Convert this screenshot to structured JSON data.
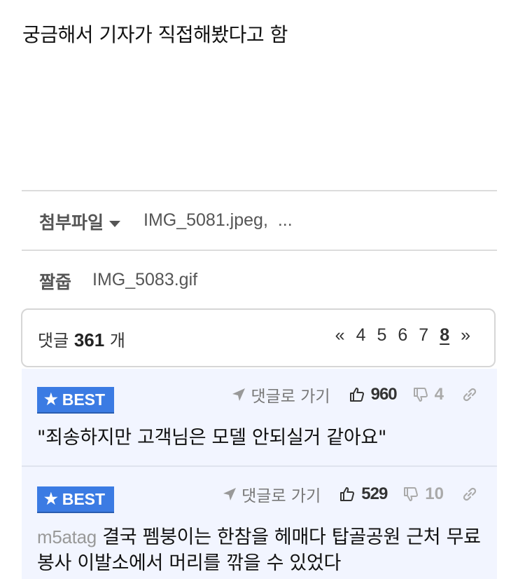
{
  "post": {
    "body_text": "궁금해서 기자가 직접해봤다고 함"
  },
  "attachments": {
    "label": "첨부파일",
    "files": "IMG_5081.jpeg,",
    "more": "..."
  },
  "short_clip": {
    "label": "짤줍",
    "file": "IMG_5083.gif"
  },
  "comments_header": {
    "prefix": "댓글",
    "count": "361",
    "suffix": "개",
    "pager": {
      "prev": "«",
      "pages": [
        "4",
        "5",
        "6",
        "7",
        "8"
      ],
      "current": "8",
      "next": "»"
    }
  },
  "comments": [
    {
      "badge": "BEST",
      "goto_label": "댓글로 가기",
      "likes": "960",
      "dislikes": "4",
      "author": "",
      "text": "\"죄송하지만 고객님은 모델 안되실거 같아요\""
    },
    {
      "badge": "BEST",
      "goto_label": "댓글로 가기",
      "likes": "529",
      "dislikes": "10",
      "author": "m5atag",
      "text": "결국 펨붕이는 한참을 헤매다 탑골공원 근처 무료봉사 이발소에서 머리를 깎을 수 있었다"
    }
  ],
  "colors": {
    "best_badge": "#3b7be3",
    "comment_bg": "#f2f5ff"
  }
}
